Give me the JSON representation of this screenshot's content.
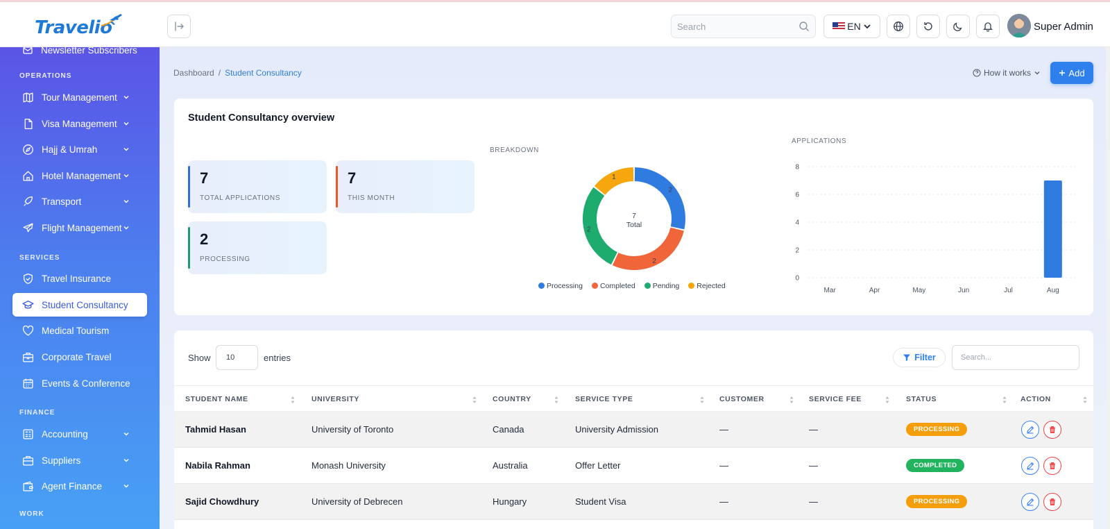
{
  "brand": {
    "name": "Travelio"
  },
  "header": {
    "search_placeholder": "Search",
    "language": "EN",
    "user_name": "Super Admin",
    "icons": [
      "collapse-icon",
      "search-icon",
      "flag-us-icon",
      "globe-icon",
      "refresh-icon",
      "moon-icon",
      "bell-icon"
    ]
  },
  "sidebar": {
    "partial_item": "Newsletter Subscribers",
    "sections": [
      "OPERATIONS",
      "SERVICES",
      "FINANCE",
      "WORK"
    ],
    "operations": [
      {
        "label": "Tour Management",
        "icon": "map-icon"
      },
      {
        "label": "Visa Management",
        "icon": "document-icon"
      },
      {
        "label": "Hajj & Umrah",
        "icon": "compass-icon"
      },
      {
        "label": "Hotel Management",
        "icon": "home-icon"
      },
      {
        "label": "Transport",
        "icon": "rocket-icon"
      },
      {
        "label": "Flight Management",
        "icon": "plane-icon"
      }
    ],
    "services": [
      {
        "label": "Travel Insurance",
        "icon": "shield-icon"
      },
      {
        "label": "Student Consultancy",
        "icon": "graduation-cap-icon"
      },
      {
        "label": "Medical Tourism",
        "icon": "heart-icon"
      },
      {
        "label": "Corporate Travel",
        "icon": "briefcase-icon"
      },
      {
        "label": "Events & Conference",
        "icon": "calendar-icon"
      }
    ],
    "finance": [
      {
        "label": "Accounting",
        "icon": "calculator-icon"
      },
      {
        "label": "Suppliers",
        "icon": "suitcase-icon"
      },
      {
        "label": "Agent Finance",
        "icon": "wallet-icon"
      }
    ]
  },
  "breadcrumb": {
    "root": "Dashboard",
    "separator": "/",
    "current": "Student Consultancy"
  },
  "page_actions": {
    "how_it_works": "How it works",
    "add": "Add"
  },
  "overview": {
    "title": "Student Consultancy overview",
    "stats": [
      {
        "value": "7",
        "label": "TOTAL APPLICATIONS",
        "color": "#2f6fd6"
      },
      {
        "value": "7",
        "label": "THIS MONTH",
        "color": "#e8582c"
      },
      {
        "value": "2",
        "label": "PROCESSING",
        "color": "#1a9c6b"
      }
    ],
    "breakdown_title": "BREAKDOWN",
    "applications_title": "APPLICATIONS",
    "donut_center": {
      "value": "7",
      "label": "Total"
    }
  },
  "chart_data": [
    {
      "type": "pie",
      "title": "BREAKDOWN",
      "donut": true,
      "categories": [
        "Processing",
        "Completed",
        "Pending",
        "Rejected"
      ],
      "values": [
        2,
        2,
        2,
        1
      ],
      "colors": [
        "#2f7be0",
        "#f0663a",
        "#1eab6e",
        "#f5a70d"
      ],
      "legend": "bottom"
    },
    {
      "type": "bar",
      "title": "APPLICATIONS",
      "categories": [
        "Mar",
        "Apr",
        "May",
        "Jun",
        "Jul",
        "Aug"
      ],
      "values": [
        0,
        0,
        0,
        0,
        0,
        7
      ],
      "ylim": [
        0,
        8
      ],
      "yticks": [
        0,
        2,
        4,
        6,
        8
      ],
      "color": "#2f7be0",
      "grid": true
    }
  ],
  "table": {
    "show_label": "Show",
    "entries_value": "10",
    "entries_label": "entries",
    "filter_label": "Filter",
    "search_placeholder": "Search...",
    "columns": [
      "STUDENT NAME",
      "UNIVERSITY",
      "COUNTRY",
      "SERVICE TYPE",
      "CUSTOMER",
      "SERVICE FEE",
      "STATUS",
      "ACTION"
    ],
    "rows": [
      {
        "student": "Tahmid Hasan",
        "university": "University of Toronto",
        "country": "Canada",
        "service": "University Admission",
        "customer": "—",
        "fee": "—",
        "status": "PROCESSING"
      },
      {
        "student": "Nabila Rahman",
        "university": "Monash University",
        "country": "Australia",
        "service": "Offer Letter",
        "customer": "—",
        "fee": "—",
        "status": "COMPLETED"
      },
      {
        "student": "Sajid Chowdhury",
        "university": "University of Debrecen",
        "country": "Hungary",
        "service": "Student Visa",
        "customer": "—",
        "fee": "—",
        "status": "PROCESSING"
      }
    ]
  }
}
